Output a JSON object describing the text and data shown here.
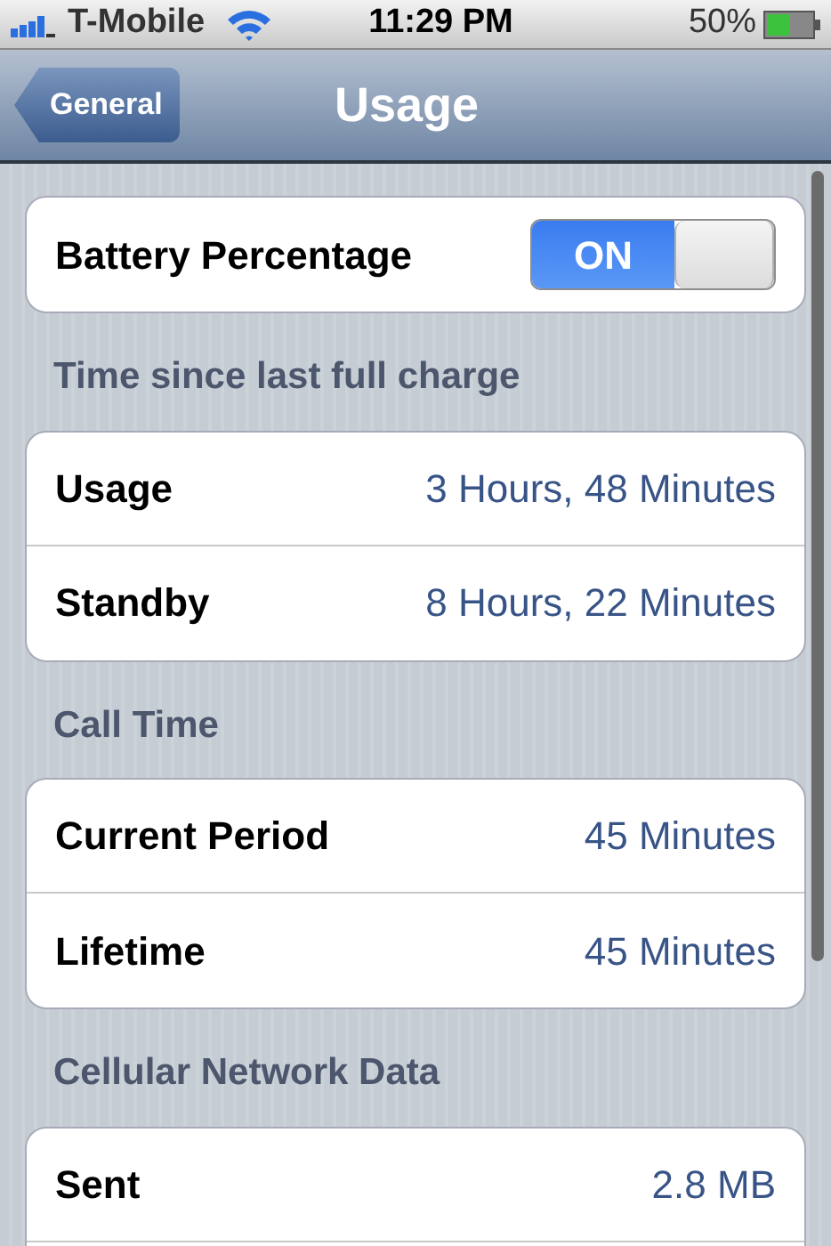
{
  "status_bar": {
    "carrier": "T-Mobile",
    "time": "11:29 PM",
    "battery": "50%"
  },
  "nav_bar": {
    "back": "General",
    "title": "Usage"
  },
  "sections": [
    {
      "rows": [
        {
          "kind": "toggle",
          "label": "Battery Percentage",
          "on": true,
          "toggle_text": "ON"
        }
      ]
    },
    {
      "header": "Time since last full charge",
      "rows": [
        {
          "kind": "value",
          "label": "Usage",
          "value": "3 Hours, 48 Minutes"
        },
        {
          "kind": "value",
          "label": "Standby",
          "value": "8 Hours, 22 Minutes"
        }
      ]
    },
    {
      "header": "Call Time",
      "rows": [
        {
          "kind": "value",
          "label": "Current Period",
          "value": "45 Minutes"
        },
        {
          "kind": "value",
          "label": "Lifetime",
          "value": "45 Minutes"
        }
      ]
    },
    {
      "header": "Cellular Network Data",
      "rows": [
        {
          "kind": "value",
          "label": "Sent",
          "value": "2.8 MB"
        },
        {
          "kind": "blank"
        }
      ]
    }
  ]
}
